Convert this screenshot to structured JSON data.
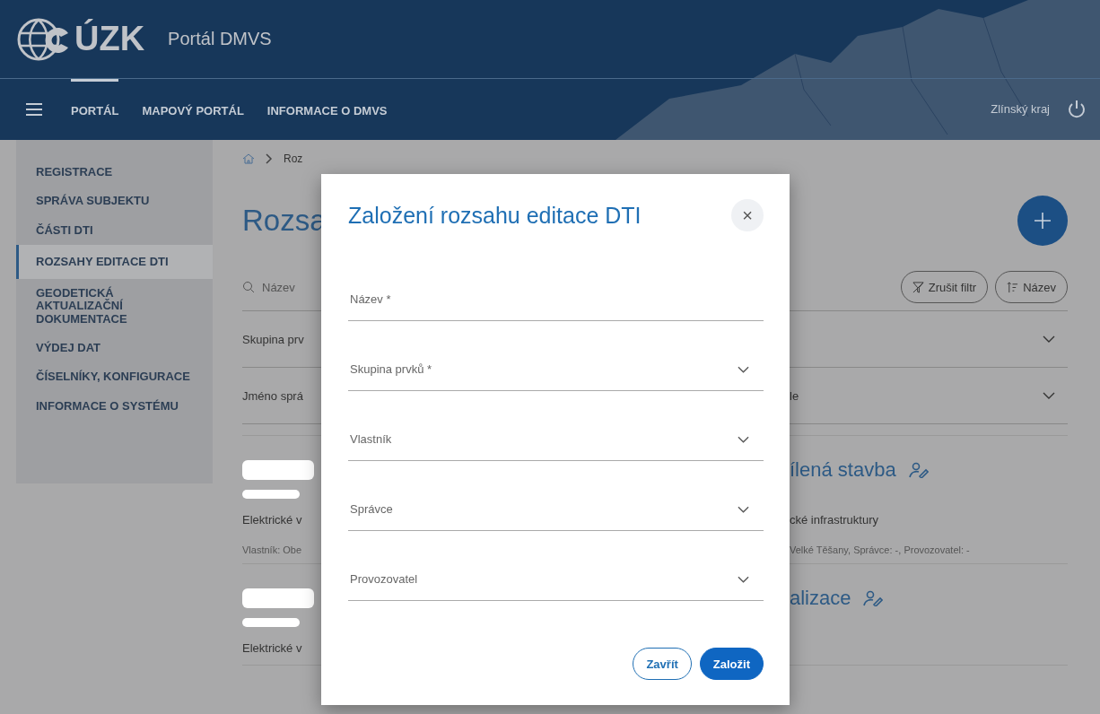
{
  "header": {
    "logo": "ÚZK",
    "title": "Portál DMVS"
  },
  "nav": {
    "items": [
      {
        "label": "PORTÁL",
        "selected": true
      },
      {
        "label": "MAPOVÝ PORTÁL",
        "selected": false
      },
      {
        "label": "INFORMACE O DMVS",
        "selected": false
      }
    ],
    "region": "Zlínský kraj"
  },
  "sidebar": {
    "items": [
      {
        "label": "REGISTRACE",
        "selected": false
      },
      {
        "label": "SPRÁVA SUBJEKTU",
        "selected": false
      },
      {
        "label": "ČÁSTI DTI",
        "selected": false
      },
      {
        "label": "ROZSAHY EDITACE DTI",
        "selected": true
      },
      {
        "label": "GEODETICKÁ\nAKTUALIZAČNÍ\nDOKUMENTACE",
        "selected": false
      },
      {
        "label": "VÝDEJ DAT",
        "selected": false
      },
      {
        "label": "ČÍSELNÍKY, KONFIGURACE",
        "selected": false
      },
      {
        "label": "INFORMACE O SYSTÉMU",
        "selected": false
      }
    ]
  },
  "page": {
    "breadcrumb": "Roz",
    "title": "Rozsa",
    "search": {
      "placeholder": "Název"
    },
    "actions": [
      {
        "label": "Zrušit filtr",
        "kind": "filter"
      },
      {
        "label": "Název",
        "kind": "sort"
      }
    ],
    "filters": [
      {
        "left": "Skupina prv"
      },
      {
        "left": "Jméno sprá",
        "right": "le"
      }
    ],
    "cards": [
      {
        "title_right": "ílená stavba",
        "line_left": "Elektrické v",
        "line_right": "cké infrastruktury",
        "meta_left": "Vlastník: Obe",
        "meta_right": "Velké Těšany, Správce: -, Provozovatel: -"
      },
      {
        "title_right": "alizace",
        "line_left": "Elektrické v"
      }
    ]
  },
  "dialog": {
    "title": "Založení rozsahu editace DTI",
    "close": "×",
    "fields": [
      {
        "placeholder": "Název *",
        "kind": "text"
      },
      {
        "placeholder": "Skupina prvků *",
        "kind": "select"
      },
      {
        "placeholder": "Vlastník",
        "kind": "select"
      },
      {
        "placeholder": "Správce",
        "kind": "select"
      },
      {
        "placeholder": "Provozovatel",
        "kind": "select"
      }
    ],
    "buttons": [
      {
        "label": "Zavřít",
        "kind": "secondary"
      },
      {
        "label": "Založit",
        "kind": "primary"
      }
    ]
  }
}
